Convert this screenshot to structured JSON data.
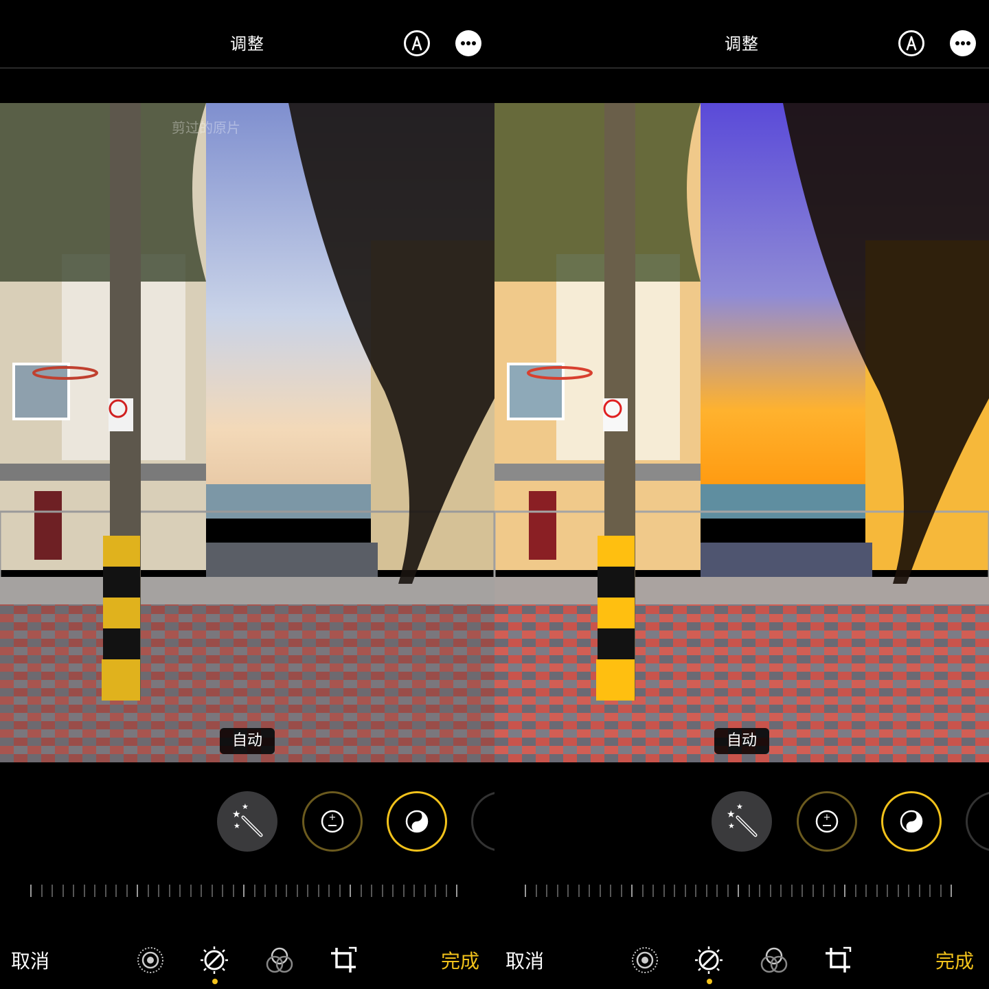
{
  "panels": [
    {
      "header": {
        "title": "调整"
      },
      "photo": {
        "overlay_label": "剪过的原片",
        "auto_badge": "自动"
      },
      "tools": [
        "auto-enhance",
        "exposure",
        "brilliance"
      ],
      "bottom_bar": {
        "cancel_label": "取消",
        "done_label": "完成",
        "active_tab": "adjust"
      }
    },
    {
      "header": {
        "title": "调整"
      },
      "photo": {
        "overlay_label": "",
        "auto_badge": "自动"
      },
      "tools": [
        "auto-enhance",
        "exposure",
        "brilliance"
      ],
      "bottom_bar": {
        "cancel_label": "取消",
        "done_label": "完成",
        "active_tab": "adjust"
      }
    }
  ],
  "colors": {
    "accent": "#f2c21b",
    "background": "#000000",
    "button_gray": "#3a3a3c"
  },
  "icons": [
    "markup-icon",
    "more-icon",
    "magic-wand-icon",
    "exposure-icon",
    "brilliance-icon",
    "live-photo-icon",
    "adjust-icon",
    "filters-icon",
    "crop-icon"
  ]
}
